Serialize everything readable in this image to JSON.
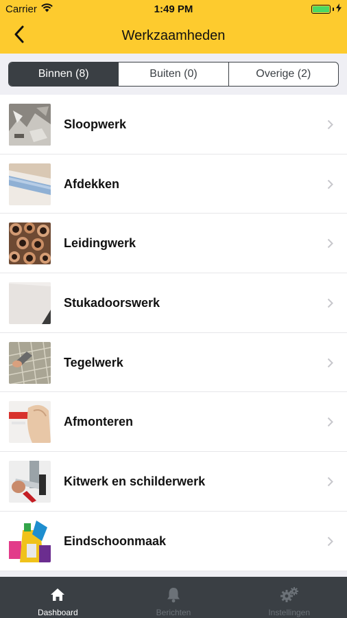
{
  "status_bar": {
    "carrier": "Carrier",
    "time": "1:49 PM",
    "battery_level": 1.0,
    "battery_color": "#4cd964"
  },
  "header": {
    "title": "Werkzaamheden",
    "back_icon": "chevron-left-icon",
    "background": "#fdcb2e"
  },
  "segments": [
    {
      "label": "Binnen (8)",
      "active": true
    },
    {
      "label": "Buiten (0)",
      "active": false
    },
    {
      "label": "Overige (2)",
      "active": false
    }
  ],
  "items": [
    {
      "label": "Sloopwerk",
      "thumb": "demolition-rubble"
    },
    {
      "label": "Afdekken",
      "thumb": "covering-roll"
    },
    {
      "label": "Leidingwerk",
      "thumb": "pipes"
    },
    {
      "label": "Stukadoorswerk",
      "thumb": "plaster-wall"
    },
    {
      "label": "Tegelwerk",
      "thumb": "tiling"
    },
    {
      "label": "Afmonteren",
      "thumb": "finishing-hands"
    },
    {
      "label": "Kitwerk en schilderwerk",
      "thumb": "caulking-gun"
    },
    {
      "label": "Eindschoonmaak",
      "thumb": "cleaning-supplies"
    }
  ],
  "tab_bar": {
    "tabs": [
      {
        "label": "Dashboard",
        "icon": "home-icon",
        "active": true
      },
      {
        "label": "Berichten",
        "icon": "bell-icon",
        "active": false
      },
      {
        "label": "Instellingen",
        "icon": "gears-icon",
        "active": false
      }
    ]
  }
}
